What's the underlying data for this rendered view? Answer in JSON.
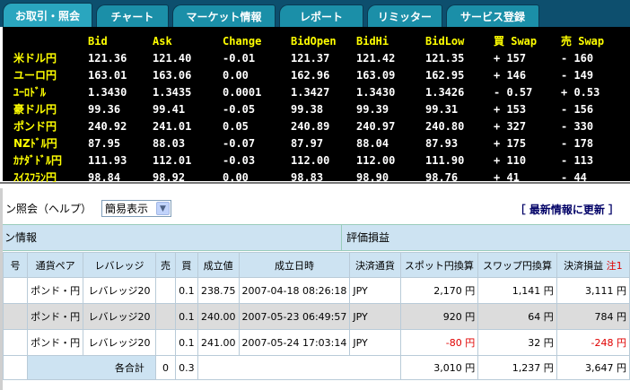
{
  "tabs": [
    {
      "label": "お取引・照会",
      "active": true
    },
    {
      "label": "チャート",
      "active": false
    },
    {
      "label": "マーケット情報",
      "active": false
    },
    {
      "label": "レポート",
      "active": false
    },
    {
      "label": "リミッター",
      "active": false
    },
    {
      "label": "サービス登録",
      "active": false
    }
  ],
  "rates": {
    "columns": [
      "",
      "Bid",
      "Ask",
      "Change",
      "BidOpen",
      "BidHi",
      "BidLow",
      "買 Swap",
      "売 Swap"
    ],
    "rows": [
      [
        "米ドル円",
        "121.36",
        "121.40",
        "-0.01",
        "121.37",
        "121.42",
        "121.35",
        "+ 157",
        "- 160"
      ],
      [
        "ユーロ円",
        "163.01",
        "163.06",
        "0.00",
        "162.96",
        "163.09",
        "162.95",
        "+ 146",
        "- 149"
      ],
      [
        "ﾕｰﾛﾄﾞﾙ",
        "1.3430",
        "1.3435",
        "0.0001",
        "1.3427",
        "1.3430",
        "1.3426",
        "- 0.57",
        "+ 0.53"
      ],
      [
        "豪ドル円",
        "99.36",
        "99.41",
        "-0.05",
        "99.38",
        "99.39",
        "99.31",
        "+ 153",
        "- 156"
      ],
      [
        "ポンド円",
        "240.92",
        "241.01",
        "0.05",
        "240.89",
        "240.97",
        "240.80",
        "+ 327",
        "- 330"
      ],
      [
        "NZﾄﾞﾙ円",
        "87.95",
        "88.03",
        "-0.07",
        "87.97",
        "88.04",
        "87.93",
        "+ 175",
        "- 178"
      ],
      [
        "ｶﾅﾀﾞﾄﾞﾙ円",
        "111.93",
        "112.01",
        "-0.03",
        "112.00",
        "112.00",
        "111.90",
        "+ 110",
        "- 113"
      ],
      [
        "ｽｲｽﾌﾗﾝ円",
        "98.84",
        "98.92",
        "0.00",
        "98.83",
        "98.90",
        "98.76",
        "+ 41",
        "- 44"
      ]
    ]
  },
  "panel": {
    "title": "ン照会（ヘルプ）",
    "select_value": "簡易表示",
    "refresh": "［ 最新情報に更新 ］",
    "band_left": "ン情報",
    "band_right": "評価損益"
  },
  "positions": {
    "headers": [
      "号",
      "通貨ペア",
      "レバレッジ",
      "売",
      "買",
      "成立値",
      "成立日時",
      "決済通貨",
      "スポット円換算",
      "スワップ円換算",
      "決済損益"
    ],
    "note": "注1",
    "rows": [
      {
        "pair": "ポンド・円",
        "leverage": "レバレッジ20",
        "sell": "",
        "buy": "0.1",
        "price": "238.75",
        "datetime": "2007-04-18 08:26:18",
        "currency": "JPY",
        "spot": "2,170 円",
        "swap": "1,141 円",
        "pl": "3,111 円",
        "spot_neg": false,
        "pl_neg": false
      },
      {
        "pair": "ポンド・円",
        "leverage": "レバレッジ20",
        "sell": "",
        "buy": "0.1",
        "price": "240.00",
        "datetime": "2007-05-23 06:49:57",
        "currency": "JPY",
        "spot": "920 円",
        "swap": "64 円",
        "pl": "784 円",
        "spot_neg": false,
        "pl_neg": false
      },
      {
        "pair": "ポンド・円",
        "leverage": "レバレッジ20",
        "sell": "",
        "buy": "0.1",
        "price": "241.00",
        "datetime": "2007-05-24 17:03:14",
        "currency": "JPY",
        "spot": "-80 円",
        "swap": "32 円",
        "pl": "-248 円",
        "spot_neg": true,
        "pl_neg": true
      }
    ],
    "total": {
      "label": "各合計",
      "sell": "0",
      "buy": "0.3",
      "spot": "3,010 円",
      "swap": "1,237 円",
      "pl": "3,647 円"
    }
  }
}
